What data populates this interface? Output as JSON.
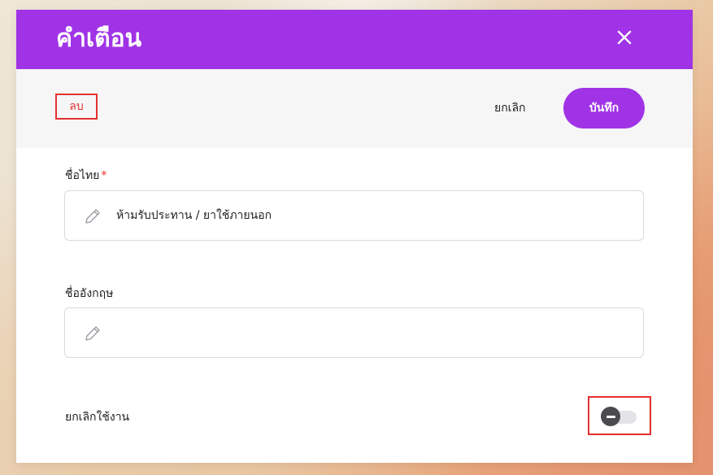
{
  "dialog": {
    "title": "คำเตือน",
    "close_icon": "close-icon"
  },
  "toolbar": {
    "delete_label": "ลบ",
    "cancel_label": "ยกเลิก",
    "save_label": "บันทึก"
  },
  "form": {
    "thai_name": {
      "label": "ชื่อไทย",
      "required_mark": "*",
      "value": "ห้ามรับประทาน / ยาใช้ภายนอก",
      "icon": "pencil-icon"
    },
    "english_name": {
      "label": "ชื่ออังกฤษ",
      "value": "",
      "icon": "pencil-icon"
    },
    "disable": {
      "label": "ยกเลิกใช้งาน",
      "state": "off"
    }
  },
  "colors": {
    "primary": "#a033e6",
    "danger": "#e33131"
  }
}
